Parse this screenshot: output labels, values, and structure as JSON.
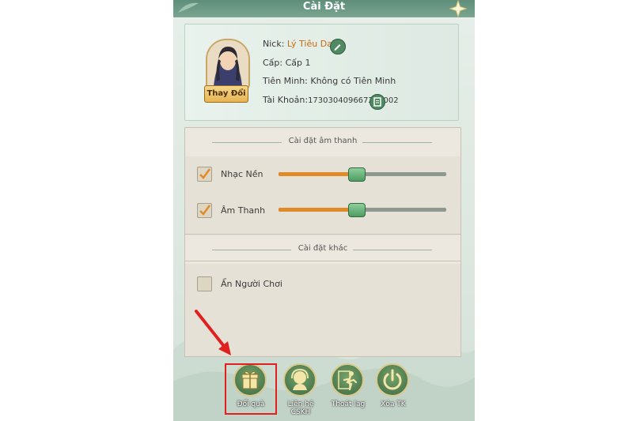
{
  "window": {
    "title": "Cài Đặt"
  },
  "profile": {
    "nick_label": "Nick:",
    "nick_value": "Lý Tiêu Dao",
    "level_label": "Cấp:",
    "level_value": "Cấp 1",
    "guild_label": "Tiên Minh:",
    "guild_value": "Không có Tiên Minh",
    "account_label": "Tài Khoản:",
    "account_value": "173030409667202002",
    "change_button": "Thay Đổi"
  },
  "sound_section": {
    "title": "Cài đặt âm thanh",
    "music": {
      "label": "Nhạc Nền",
      "checked": true,
      "level": 0.46
    },
    "sfx": {
      "label": "Âm Thanh",
      "checked": true,
      "level": 0.46
    }
  },
  "other_section": {
    "title": "Cài đặt khác",
    "hide_players": {
      "label": "Ẩn Người Chơi",
      "checked": false
    }
  },
  "bottom_buttons": [
    {
      "label": "Đổi quà",
      "icon": "gift-icon"
    },
    {
      "label": "Liên hệ CSKH",
      "icon": "support-icon"
    },
    {
      "label": "Thoát lag",
      "icon": "running-man-icon"
    },
    {
      "label": "Xóa TK",
      "icon": "power-icon"
    }
  ],
  "colors": {
    "accent_orange": "#e08a28",
    "highlight_red": "#e02020",
    "knob_green": "#4f9b63"
  }
}
